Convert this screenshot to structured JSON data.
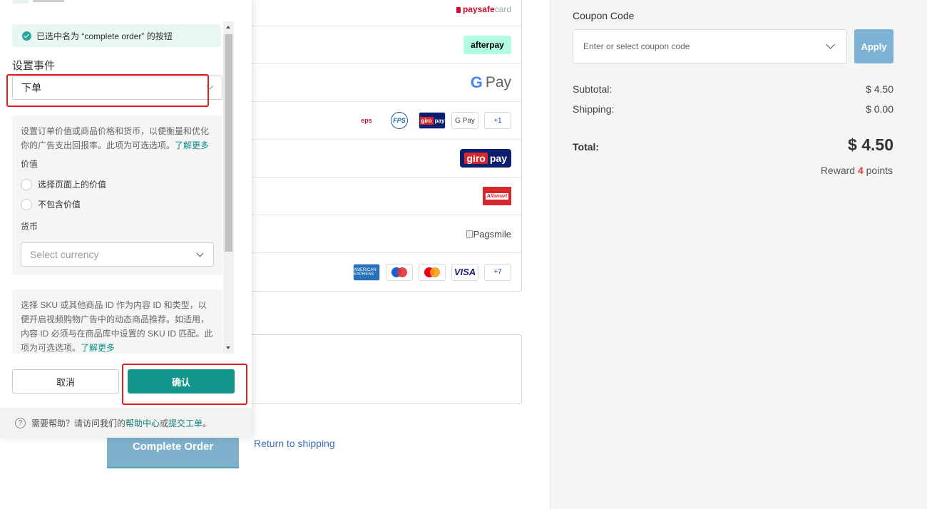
{
  "payment_list": {
    "paysafe_logo": "paysafecard",
    "paysafe_main": "paysafe",
    "paysafe_suffix": "card",
    "afterpay_logo": "afterpay",
    "gpay_logo_g": "G",
    "gpay_logo_text": "Pay",
    "eps_logo": "eps",
    "fps_logo": "FPS",
    "giropay_small_left": "giro",
    "giropay_small_right": "pay",
    "gpay_small": "G Pay",
    "row3_more": "+1",
    "giropay_left": "giro",
    "giropay_right": "pay",
    "alfamart_logo": "Alfamart",
    "pagsmile_alt": "Pagsmile",
    "amex_logo": "AMERICAN EXPRESS",
    "visa_logo": "VISA",
    "cards_more": "+7"
  },
  "actions": {
    "complete_order": "Complete Order",
    "return_link": "Return to shipping"
  },
  "summary": {
    "coupon_label": "Coupon Code",
    "coupon_placeholder": "Enter or select coupon code",
    "apply": "Apply",
    "subtotal_label": "Subtotal:",
    "subtotal_value": "$ 4.50",
    "shipping_label": "Shipping:",
    "shipping_value": "$ 0.00",
    "total_label": "Total:",
    "total_value": "$ 4.50",
    "reward_prefix": "Reward",
    "reward_points": "4",
    "reward_suffix": "points"
  },
  "panel": {
    "notice": "已选中名为 “complete order” 的按钮",
    "event_label": "设置事件",
    "event_value": "下单",
    "value_help": "设置订单价值或商品价格和货币，以便衡量和优化你的广告支出回报率。此项为可选选项。",
    "learn_more_1": "了解更多",
    "value_label": "价值",
    "radio_page_value": "选择页面上的价值",
    "radio_no_value": "不包含价值",
    "currency_label": "货币",
    "currency_placeholder": "Select currency",
    "sku_help": "选择 SKU 或其他商品 ID 作为内容 ID 和类型，以便开启视频购物广告中的动态商品推荐。如适用，内容 ID 必须与在商品库中设置的 SKU ID 匹配。此项为可选选项。",
    "learn_more_2": "了解更多",
    "cancel": "取消",
    "confirm": "确认",
    "help_prefix": "需要帮助？请访问我们的",
    "help_center": "帮助中心",
    "help_or": "或",
    "submit_ticket": "提交工单",
    "help_end": "。"
  },
  "colors": {
    "accent": "#12968c",
    "highlight": "#e02020",
    "apply_button": "#7fb3d5",
    "complete_button": "#7fb0cc"
  }
}
